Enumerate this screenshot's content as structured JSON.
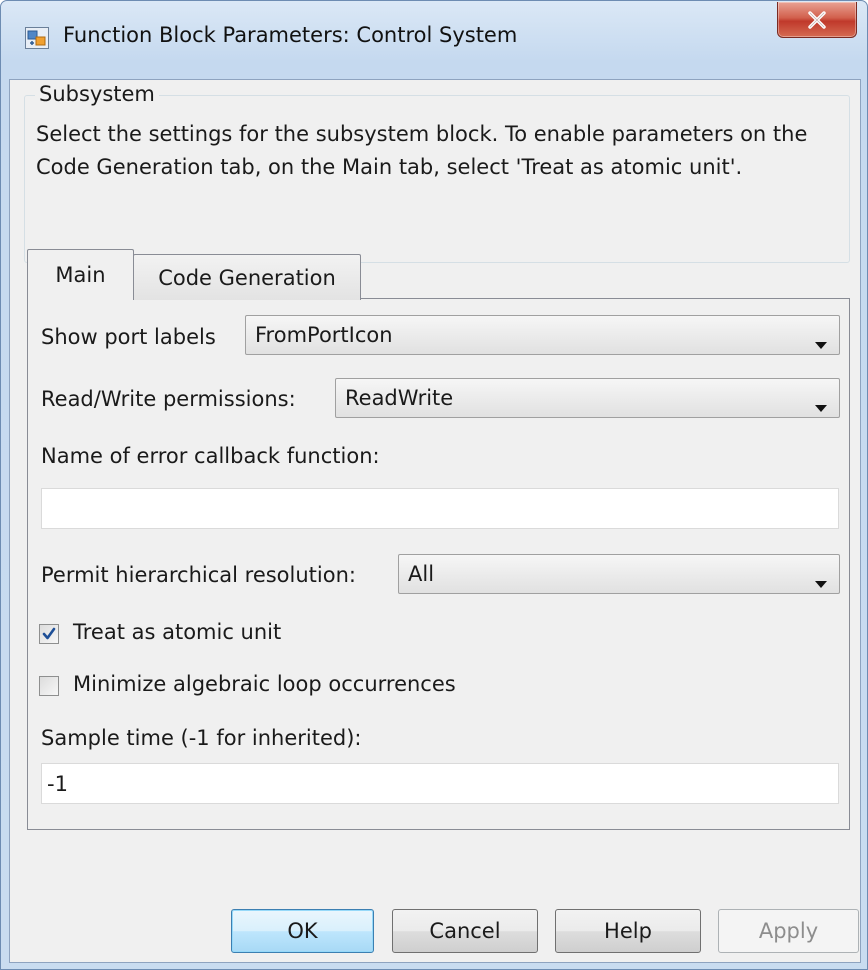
{
  "window": {
    "title": "Function Block Parameters: Control System",
    "close_label": "X"
  },
  "subsystem": {
    "group_title": "Subsystem",
    "description": "Select the settings for the subsystem block. To enable parameters on the Code Generation tab, on the Main tab, select 'Treat as atomic unit'."
  },
  "tabs": [
    {
      "label": "Main",
      "selected": true
    },
    {
      "label": "Code Generation",
      "selected": false
    }
  ],
  "main": {
    "show_port_labels": {
      "label": "Show port labels",
      "value": "FromPortIcon"
    },
    "read_write": {
      "label": "Read/Write permissions:",
      "value": "ReadWrite"
    },
    "error_callback": {
      "label": "Name of error callback function:",
      "value": ""
    },
    "hier_resolution": {
      "label": "Permit hierarchical resolution:",
      "value": "All"
    },
    "atomic_unit": {
      "label": "Treat as atomic unit",
      "checked": true
    },
    "minimize_loop": {
      "label": "Minimize algebraic loop occurrences",
      "checked": false
    },
    "sample_time": {
      "label": "Sample time (-1 for inherited):",
      "value": "-1"
    }
  },
  "buttons": {
    "ok": "OK",
    "cancel": "Cancel",
    "help": "Help",
    "apply": "Apply"
  },
  "colors": {
    "title_bar": "#c5d9ef",
    "close_button": "#c0392b",
    "checkmark": "#1e4f97",
    "default_button": "#bee6fd"
  },
  "icons": {
    "app": "simulink-block-icon",
    "close": "close-x-icon",
    "dropdown": "triangle-down-icon",
    "check": "checkmark-icon"
  }
}
